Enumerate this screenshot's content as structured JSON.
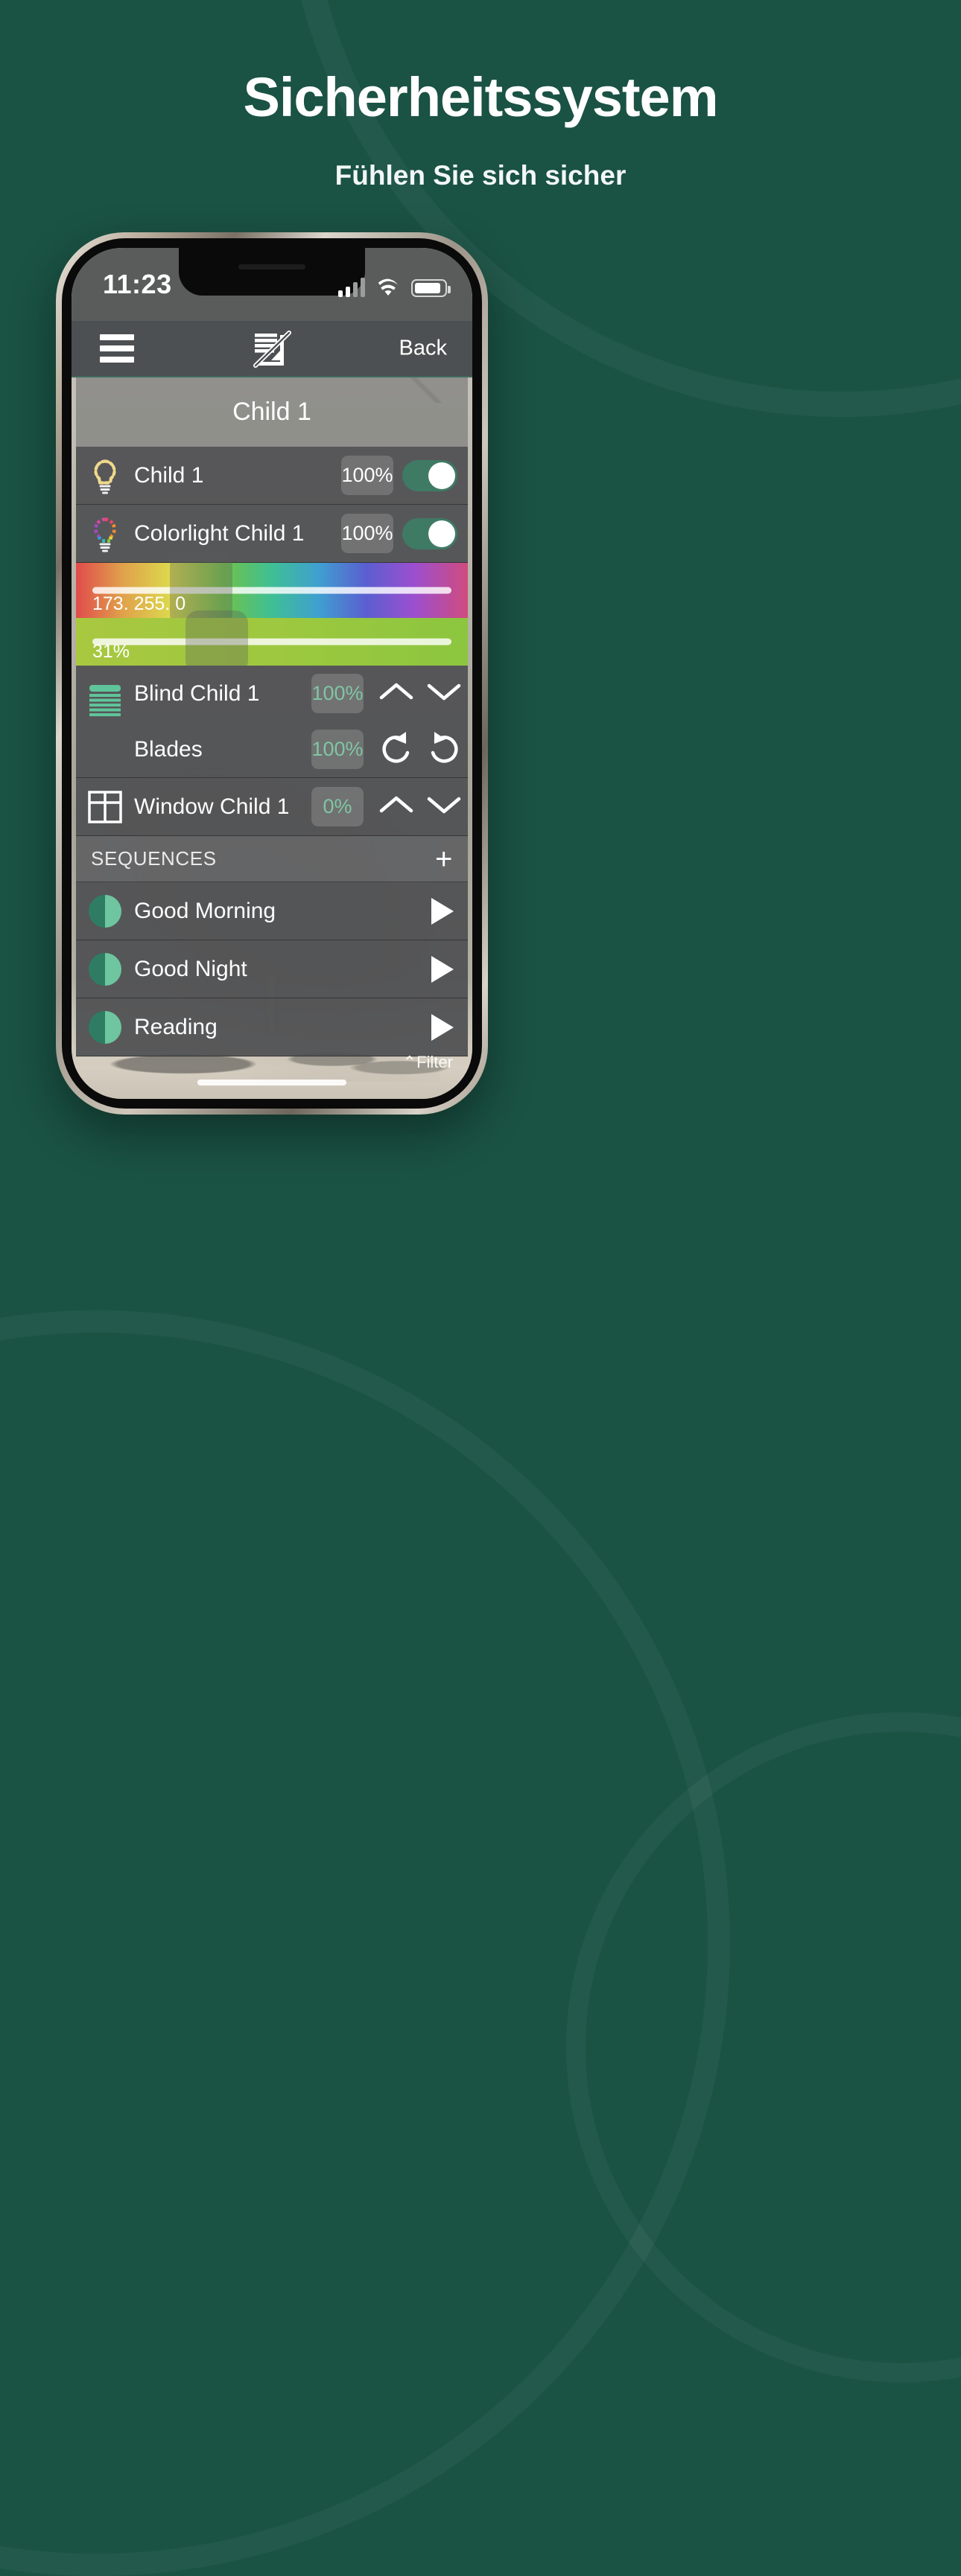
{
  "hero": {
    "title": "Sicherheitssystem",
    "subtitle": "Fühlen Sie sich sicher",
    "bg_color": "#1a5244"
  },
  "phone": {
    "status_bar": {
      "time": "11:23",
      "signal_icon": "cellular-signal-icon",
      "wifi_icon": "wifi-icon",
      "battery_icon": "battery-icon"
    },
    "nav_bar": {
      "menu_icon": "hamburger-menu-icon",
      "logo_icon": "blind-slash-logo-icon",
      "back_label": "Back"
    },
    "card_title": "Child 1",
    "devices": [
      {
        "icon": "yellow-bulb-icon",
        "name": "Child 1",
        "value": "100%",
        "toggle_on": true
      },
      {
        "icon": "color-bulb-icon",
        "name": "Colorlight Child 1",
        "value": "100%",
        "toggle_on": true
      }
    ],
    "color_slider": {
      "value_label": "173. 255. 0",
      "knob_position_pct": 31
    },
    "brightness_slider": {
      "value_label": "31%",
      "knob_position_pct": 31
    },
    "blind_group": {
      "icon": "blind-icon",
      "rows": [
        {
          "label": "Blind Child 1",
          "value": "100%",
          "up_icon": "chevron-up-icon",
          "down_icon": "chevron-down-icon"
        },
        {
          "label": "Blades",
          "value": "100%",
          "up_icon": "rotate-left-icon",
          "down_icon": "rotate-right-icon"
        }
      ]
    },
    "window_row": {
      "icon": "window-icon",
      "label": "Window Child 1",
      "value": "0%",
      "up_icon": "chevron-up-icon",
      "down_icon": "chevron-down-icon"
    },
    "sequences_header": {
      "title": "SEQUENCES",
      "add_icon": "plus-icon"
    },
    "sequences": [
      {
        "icon": "pie-progress-icon",
        "name": "Good Morning",
        "play_icon": "play-icon"
      },
      {
        "icon": "pie-progress-icon",
        "name": "Good Night",
        "play_icon": "play-icon"
      },
      {
        "icon": "pie-progress-icon",
        "name": "Reading",
        "play_icon": "play-icon"
      }
    ],
    "filter_label": "Filter",
    "accent_color": "#3f7a65"
  }
}
